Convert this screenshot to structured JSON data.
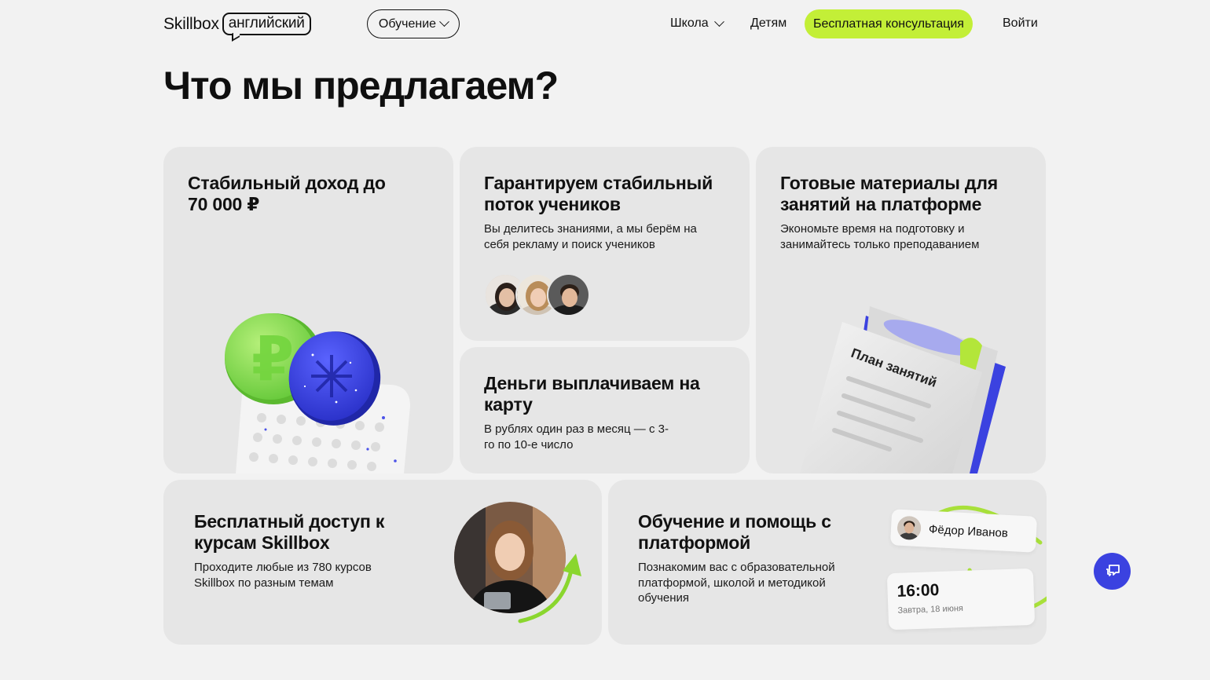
{
  "header": {
    "logo_word": "Skillbox",
    "logo_badge": "английский",
    "education_label": "Обучение",
    "school_label": "Школа",
    "kids_label": "Детям",
    "consult_label": "Бесплатная консультация",
    "login_label": "Войти"
  },
  "page": {
    "title": "Что мы предлагаем?"
  },
  "cards": {
    "income": {
      "title": "Стабильный доход до 70 000 ₽"
    },
    "students": {
      "title": "Гарантируем стабильный поток учеников",
      "text": "Вы делитесь знаниями, а мы берём на себя рекламу и поиск учеников"
    },
    "materials": {
      "title": "Готовые материалы для занятий на платформе",
      "text": "Экономьте время на подготовку и занимайтесь только преподаванием",
      "book_label": "План занятий"
    },
    "payments": {
      "title": "Деньги выплачиваем на карту",
      "text": "В рублях один раз в месяц — с 3-го по 10-е число"
    },
    "courses": {
      "title": "Бесплатный доступ к курсам Skillbox",
      "text": "Проходите любые из 780 курсов Skillbox по разным темам"
    },
    "training": {
      "title": "Обучение и помощь с платформой",
      "text": "Познакомим вас с образовательной платформой, школой и методикой обучения",
      "mentor_name": "Фёдор Иванов",
      "time": "16:00",
      "date": "Завтра, 18 июня"
    }
  },
  "colors": {
    "accent_green": "#c3ef37",
    "accent_blue": "#3b42e0",
    "card_bg": "#e6e6e6",
    "page_bg": "#f2f2f2"
  },
  "icons": {
    "chat": "chat-bubbles-icon",
    "chevron": "chevron-down-icon"
  }
}
